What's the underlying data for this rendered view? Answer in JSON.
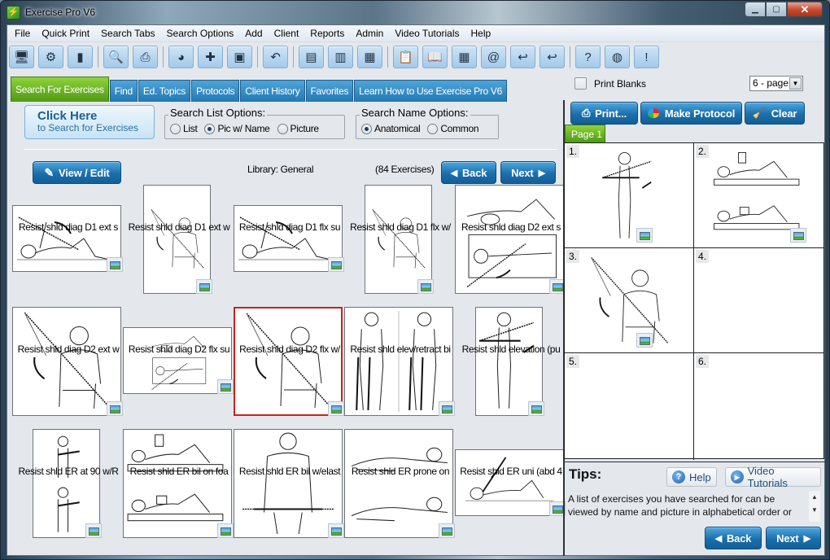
{
  "window": {
    "title": "Exercise Pro V6",
    "controls": {
      "minimize": "▁",
      "maximize": "▢",
      "close": "✕"
    }
  },
  "menu": [
    "File",
    "Quick Print",
    "Search Tabs",
    "Search Options",
    "Add",
    "Client",
    "Reports",
    "Admin",
    "Video Tutorials",
    "Help"
  ],
  "toolbar": [
    {
      "icon": "monitor-icon",
      "glyph": "🖥"
    },
    {
      "icon": "gear-icon",
      "glyph": "⚙"
    },
    {
      "icon": "document-red-icon",
      "glyph": "▮"
    },
    {
      "sep": true
    },
    {
      "icon": "search-icon",
      "glyph": "🔍"
    },
    {
      "icon": "printer-icon",
      "glyph": "⎙"
    },
    {
      "sep": true
    },
    {
      "icon": "protocol-bubble-icon",
      "glyph": "◕"
    },
    {
      "icon": "add-green-icon",
      "glyph": "✚"
    },
    {
      "icon": "new-window-icon",
      "glyph": "▣"
    },
    {
      "sep": true
    },
    {
      "icon": "undo-arrow-icon",
      "glyph": "↶"
    },
    {
      "sep": true
    },
    {
      "icon": "sheet-icon",
      "glyph": "▤"
    },
    {
      "icon": "document-blue-icon",
      "glyph": "▥"
    },
    {
      "icon": "document-red-lines-icon",
      "glyph": "▦"
    },
    {
      "sep": true
    },
    {
      "icon": "clipboard-icon",
      "glyph": "📋"
    },
    {
      "icon": "book-icon",
      "glyph": "📖"
    },
    {
      "icon": "spreadsheet-icon",
      "glyph": "▦"
    },
    {
      "icon": "address-book-icon",
      "glyph": "@"
    },
    {
      "icon": "reply-yellow-icon",
      "glyph": "↩"
    },
    {
      "icon": "reply-red-icon",
      "glyph": "↩"
    },
    {
      "sep": true
    },
    {
      "icon": "help-icon",
      "glyph": "?"
    },
    {
      "icon": "globe-icon",
      "glyph": "◍"
    },
    {
      "icon": "warning-icon",
      "glyph": "!"
    }
  ],
  "tabs": [
    {
      "label": "Search For Exercises",
      "active": true
    },
    {
      "label": "Find"
    },
    {
      "label": "Ed. Topics"
    },
    {
      "label": "Protocols"
    },
    {
      "label": "Client History"
    },
    {
      "label": "Favorites"
    },
    {
      "label": "Learn How to Use Exercise Pro V6"
    }
  ],
  "search": {
    "click_here_title": "Click Here",
    "click_here_sub": "to Search for Exercises",
    "list_options": {
      "legend": "Search List Options:",
      "options": [
        "List",
        "Pic w/ Name",
        "Picture"
      ],
      "selected": "Pic w/ Name"
    },
    "name_options": {
      "legend": "Search Name Options:",
      "options": [
        "Anatomical",
        "Common"
      ],
      "selected": "Anatomical"
    }
  },
  "results": {
    "view_edit_label": "View / Edit",
    "library_label": "Library: General",
    "count_label": "(84 Exercises)",
    "back_label": "Back",
    "next_label": "Next",
    "selected_index": 7,
    "exercises": [
      "Resist shld diag D1 ext s",
      "Resist shld diag D1 ext w",
      "Resist shld diag D1 flx su",
      "Resist shld diag D1 flx w/",
      "Resist shld diag D2 ext s",
      "Resist shld diag D2 ext w",
      "Resist shld diag D2 flx su",
      "Resist shld diag D2 flx w/",
      "Resist shld elev/retract bi",
      "Resist shld elevation (pu",
      "Resist shld ER at 90 w/R",
      "Resist shld ER bil on foa",
      "Resist shld ER bil w/elast",
      "Resist shld ER prone on",
      "Resist shld ER uni (abd 4"
    ]
  },
  "protocol": {
    "print_blanks_label": "Print Blanks",
    "print_blanks_checked": false,
    "page_layout": "6 - page",
    "print_label": "Print...",
    "make_protocol_label": "Make Protocol",
    "clear_label": "Clear",
    "page_tab": "Page 1",
    "slots": [
      {
        "num": "1.",
        "filled": true
      },
      {
        "num": "2.",
        "filled": true
      },
      {
        "num": "3.",
        "filled": true
      },
      {
        "num": "4.",
        "filled": false
      },
      {
        "num": "5.",
        "filled": false
      },
      {
        "num": "6.",
        "filled": false
      }
    ]
  },
  "tips": {
    "title": "Tips:",
    "help_label": "Help",
    "video_label": "Video Tutorials",
    "text": "A list of exercises you have searched for can be viewed by name and picture in alphabetical order or",
    "back_label": "Back",
    "next_label": "Next"
  }
}
